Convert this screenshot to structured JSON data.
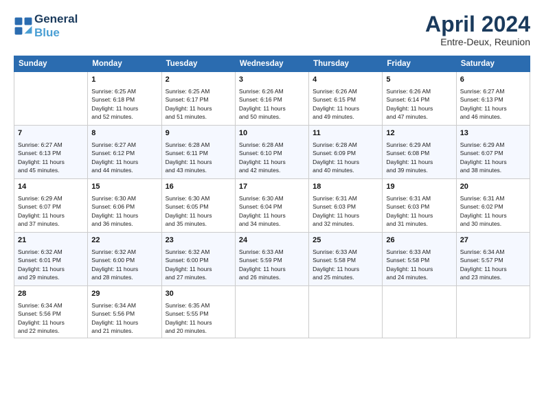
{
  "header": {
    "logo_line1": "General",
    "logo_line2": "Blue",
    "month": "April 2024",
    "location": "Entre-Deux, Reunion"
  },
  "weekdays": [
    "Sunday",
    "Monday",
    "Tuesday",
    "Wednesday",
    "Thursday",
    "Friday",
    "Saturday"
  ],
  "weeks": [
    [
      {
        "day": "",
        "sunrise": "",
        "sunset": "",
        "daylight": ""
      },
      {
        "day": "1",
        "sunrise": "Sunrise: 6:25 AM",
        "sunset": "Sunset: 6:18 PM",
        "daylight": "Daylight: 11 hours and 52 minutes."
      },
      {
        "day": "2",
        "sunrise": "Sunrise: 6:25 AM",
        "sunset": "Sunset: 6:17 PM",
        "daylight": "Daylight: 11 hours and 51 minutes."
      },
      {
        "day": "3",
        "sunrise": "Sunrise: 6:26 AM",
        "sunset": "Sunset: 6:16 PM",
        "daylight": "Daylight: 11 hours and 50 minutes."
      },
      {
        "day": "4",
        "sunrise": "Sunrise: 6:26 AM",
        "sunset": "Sunset: 6:15 PM",
        "daylight": "Daylight: 11 hours and 49 minutes."
      },
      {
        "day": "5",
        "sunrise": "Sunrise: 6:26 AM",
        "sunset": "Sunset: 6:14 PM",
        "daylight": "Daylight: 11 hours and 47 minutes."
      },
      {
        "day": "6",
        "sunrise": "Sunrise: 6:27 AM",
        "sunset": "Sunset: 6:13 PM",
        "daylight": "Daylight: 11 hours and 46 minutes."
      }
    ],
    [
      {
        "day": "7",
        "sunrise": "Sunrise: 6:27 AM",
        "sunset": "Sunset: 6:13 PM",
        "daylight": "Daylight: 11 hours and 45 minutes."
      },
      {
        "day": "8",
        "sunrise": "Sunrise: 6:27 AM",
        "sunset": "Sunset: 6:12 PM",
        "daylight": "Daylight: 11 hours and 44 minutes."
      },
      {
        "day": "9",
        "sunrise": "Sunrise: 6:28 AM",
        "sunset": "Sunset: 6:11 PM",
        "daylight": "Daylight: 11 hours and 43 minutes."
      },
      {
        "day": "10",
        "sunrise": "Sunrise: 6:28 AM",
        "sunset": "Sunset: 6:10 PM",
        "daylight": "Daylight: 11 hours and 42 minutes."
      },
      {
        "day": "11",
        "sunrise": "Sunrise: 6:28 AM",
        "sunset": "Sunset: 6:09 PM",
        "daylight": "Daylight: 11 hours and 40 minutes."
      },
      {
        "day": "12",
        "sunrise": "Sunrise: 6:29 AM",
        "sunset": "Sunset: 6:08 PM",
        "daylight": "Daylight: 11 hours and 39 minutes."
      },
      {
        "day": "13",
        "sunrise": "Sunrise: 6:29 AM",
        "sunset": "Sunset: 6:07 PM",
        "daylight": "Daylight: 11 hours and 38 minutes."
      }
    ],
    [
      {
        "day": "14",
        "sunrise": "Sunrise: 6:29 AM",
        "sunset": "Sunset: 6:07 PM",
        "daylight": "Daylight: 11 hours and 37 minutes."
      },
      {
        "day": "15",
        "sunrise": "Sunrise: 6:30 AM",
        "sunset": "Sunset: 6:06 PM",
        "daylight": "Daylight: 11 hours and 36 minutes."
      },
      {
        "day": "16",
        "sunrise": "Sunrise: 6:30 AM",
        "sunset": "Sunset: 6:05 PM",
        "daylight": "Daylight: 11 hours and 35 minutes."
      },
      {
        "day": "17",
        "sunrise": "Sunrise: 6:30 AM",
        "sunset": "Sunset: 6:04 PM",
        "daylight": "Daylight: 11 hours and 34 minutes."
      },
      {
        "day": "18",
        "sunrise": "Sunrise: 6:31 AM",
        "sunset": "Sunset: 6:03 PM",
        "daylight": "Daylight: 11 hours and 32 minutes."
      },
      {
        "day": "19",
        "sunrise": "Sunrise: 6:31 AM",
        "sunset": "Sunset: 6:03 PM",
        "daylight": "Daylight: 11 hours and 31 minutes."
      },
      {
        "day": "20",
        "sunrise": "Sunrise: 6:31 AM",
        "sunset": "Sunset: 6:02 PM",
        "daylight": "Daylight: 11 hours and 30 minutes."
      }
    ],
    [
      {
        "day": "21",
        "sunrise": "Sunrise: 6:32 AM",
        "sunset": "Sunset: 6:01 PM",
        "daylight": "Daylight: 11 hours and 29 minutes."
      },
      {
        "day": "22",
        "sunrise": "Sunrise: 6:32 AM",
        "sunset": "Sunset: 6:00 PM",
        "daylight": "Daylight: 11 hours and 28 minutes."
      },
      {
        "day": "23",
        "sunrise": "Sunrise: 6:32 AM",
        "sunset": "Sunset: 6:00 PM",
        "daylight": "Daylight: 11 hours and 27 minutes."
      },
      {
        "day": "24",
        "sunrise": "Sunrise: 6:33 AM",
        "sunset": "Sunset: 5:59 PM",
        "daylight": "Daylight: 11 hours and 26 minutes."
      },
      {
        "day": "25",
        "sunrise": "Sunrise: 6:33 AM",
        "sunset": "Sunset: 5:58 PM",
        "daylight": "Daylight: 11 hours and 25 minutes."
      },
      {
        "day": "26",
        "sunrise": "Sunrise: 6:33 AM",
        "sunset": "Sunset: 5:58 PM",
        "daylight": "Daylight: 11 hours and 24 minutes."
      },
      {
        "day": "27",
        "sunrise": "Sunrise: 6:34 AM",
        "sunset": "Sunset: 5:57 PM",
        "daylight": "Daylight: 11 hours and 23 minutes."
      }
    ],
    [
      {
        "day": "28",
        "sunrise": "Sunrise: 6:34 AM",
        "sunset": "Sunset: 5:56 PM",
        "daylight": "Daylight: 11 hours and 22 minutes."
      },
      {
        "day": "29",
        "sunrise": "Sunrise: 6:34 AM",
        "sunset": "Sunset: 5:56 PM",
        "daylight": "Daylight: 11 hours and 21 minutes."
      },
      {
        "day": "30",
        "sunrise": "Sunrise: 6:35 AM",
        "sunset": "Sunset: 5:55 PM",
        "daylight": "Daylight: 11 hours and 20 minutes."
      },
      {
        "day": "",
        "sunrise": "",
        "sunset": "",
        "daylight": ""
      },
      {
        "day": "",
        "sunrise": "",
        "sunset": "",
        "daylight": ""
      },
      {
        "day": "",
        "sunrise": "",
        "sunset": "",
        "daylight": ""
      },
      {
        "day": "",
        "sunrise": "",
        "sunset": "",
        "daylight": ""
      }
    ]
  ]
}
